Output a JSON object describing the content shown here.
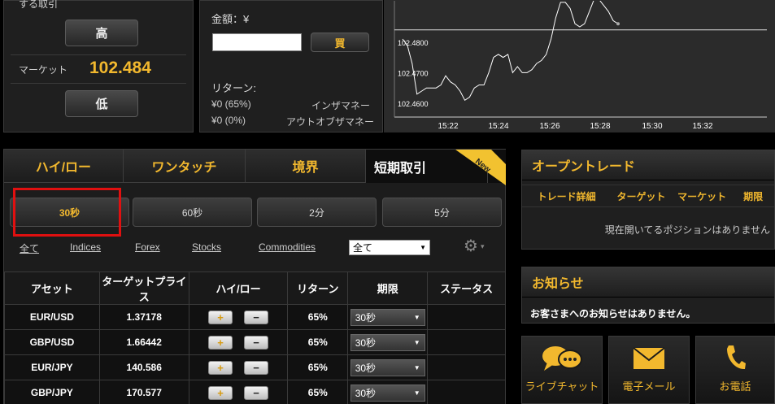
{
  "hilo_panel": {
    "cut_title": "する取引",
    "high_label": "高",
    "market_label": "マーケット",
    "market_value": "102.484",
    "low_label": "低"
  },
  "order_panel": {
    "amount_label": "金額：¥",
    "amount_value": "",
    "buy_label": "買",
    "return_label": "リターン:",
    "in_value": "¥0 (65%)",
    "in_label": "インザマネー",
    "out_value": "¥0 (0%)",
    "out_label": "アウトオブザマネー"
  },
  "chart_data": {
    "type": "line",
    "x": [
      "15:22",
      "15:24",
      "15:26",
      "15:28",
      "15:30",
      "15:32"
    ],
    "ytick_labels": [
      "102.4800",
      "102.4700",
      "102.4600"
    ],
    "ylim": [
      102.4555,
      102.4935
    ],
    "grid": false,
    "reference_line": 102.484,
    "series": [
      {
        "values": [
          102.481,
          102.479,
          102.473,
          102.463,
          102.464,
          102.465,
          102.465,
          102.465,
          102.466,
          102.469,
          102.467,
          102.466,
          102.464,
          102.461,
          102.462,
          102.465,
          102.466,
          102.466,
          102.47,
          102.475,
          102.476,
          102.475,
          102.476,
          102.47,
          102.472,
          102.47,
          102.47,
          102.471,
          102.473,
          102.474,
          102.476,
          102.481,
          102.488,
          102.493,
          102.493,
          102.491,
          102.486,
          102.485,
          102.486,
          102.49,
          102.494,
          102.494,
          102.492,
          102.49,
          102.487,
          102.486
        ]
      }
    ]
  },
  "tabs": [
    {
      "label": "ハイ/ロー"
    },
    {
      "label": "ワンタッチ"
    },
    {
      "label": "境界"
    },
    {
      "label": "短期取引"
    }
  ],
  "new_badge": "New",
  "time_buttons": [
    {
      "label": "30秒"
    },
    {
      "label": "60秒"
    },
    {
      "label": "2分"
    },
    {
      "label": "5分"
    }
  ],
  "filters": [
    {
      "label": "全て"
    },
    {
      "label": "Indices"
    },
    {
      "label": "Forex"
    },
    {
      "label": "Stocks"
    },
    {
      "label": "Commodities"
    }
  ],
  "filter_select": "全て",
  "icons": {
    "settings": "gear-icon",
    "dropdown": "chevron-down-icon",
    "chat": "speech-bubble-icon",
    "mail": "envelope-icon",
    "phone": "phone-icon"
  },
  "table": {
    "headers": [
      "アセット",
      "ターゲットプライス",
      "ハイ/ロー",
      "リターン",
      "期限",
      "ステータス"
    ],
    "rows": [
      {
        "asset": "EUR/USD",
        "target": "1.37178",
        "return": "65%",
        "expiry": "30秒"
      },
      {
        "asset": "GBP/USD",
        "target": "1.66442",
        "return": "65%",
        "expiry": "30秒"
      },
      {
        "asset": "EUR/JPY",
        "target": "140.586",
        "return": "65%",
        "expiry": "30秒"
      },
      {
        "asset": "GBP/JPY",
        "target": "170.577",
        "return": "65%",
        "expiry": "30秒"
      }
    ],
    "plus": "+",
    "minus": "−"
  },
  "open_trade": {
    "title": "オープントレード",
    "columns": [
      "トレード詳細",
      "ターゲット",
      "マーケット",
      "期限"
    ],
    "empty_msg": "現在開いてるポジションはありません"
  },
  "news": {
    "title": "お知らせ",
    "message": "お客さまへのお知らせはありません。"
  },
  "contact": [
    {
      "label": "ライブチャット"
    },
    {
      "label": "電子メール"
    },
    {
      "label": "お電話"
    }
  ],
  "colors": {
    "accent": "#f2b82e",
    "highlight_box": "#e01010"
  }
}
